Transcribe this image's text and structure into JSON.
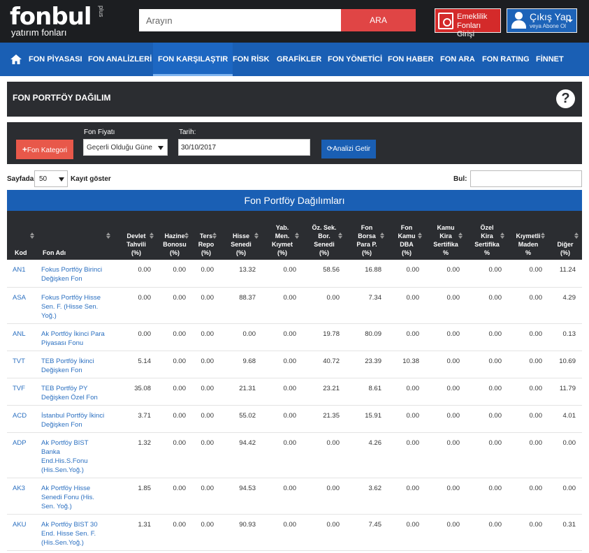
{
  "header": {
    "logo_main": "fonbul",
    "logo_plus": "plus",
    "logo_sub": "yatırım fonları",
    "search_placeholder": "Arayın",
    "search_button": "ARA",
    "emeklilik_line1": "Emeklilik",
    "emeklilik_line2": "Fonları Girişi",
    "user_line1": "Çıkış Yap",
    "user_line2": "veya Abone Ol"
  },
  "nav": {
    "items": [
      "FON PİYASASI",
      "FON ANALİZLERİ",
      "FON KARŞILAŞTIR",
      "FON RİSK",
      "GRAFİKLER",
      "FON YÖNETİCİ",
      "FON HABER",
      "FON ARA",
      "FON RATING",
      "FİNNET"
    ],
    "active_index": 2
  },
  "page": {
    "title": "FON PORTFÖY DAĞILIM",
    "help": "?"
  },
  "filters": {
    "kategori_button": "Fon Kategori",
    "fiyat_label": "Fon Fiyatı",
    "fiyat_value": "Geçerli Olduğu Güne",
    "tarih_label": "Tarih:",
    "tarih_value": "30/10/2017",
    "getir_button": "Analizi Getir"
  },
  "table_controls": {
    "sayfada": "Sayfada",
    "page_size": "50",
    "kayit": "Kayıt göster",
    "bul": "Bul:"
  },
  "table": {
    "title": "Fon Portföy Dağılımları",
    "headers": [
      [
        "Kod"
      ],
      [
        "Fon Adı"
      ],
      [
        "Devlet",
        "Tahvili",
        "(%)"
      ],
      [
        "Hazine",
        "Bonosu",
        "(%)"
      ],
      [
        "Ters",
        "Repo",
        "(%)"
      ],
      [
        "Hisse",
        "Senedi",
        "(%)"
      ],
      [
        "Yab.",
        "Men.",
        "Kıymet",
        "(%)"
      ],
      [
        "Öz. Sek.",
        "Bor.",
        "Senedi",
        "(%)"
      ],
      [
        "Fon",
        "Borsa",
        "Para P.",
        "(%)"
      ],
      [
        "Fon",
        "Kamu",
        "DBA",
        "(%)"
      ],
      [
        "Kamu",
        "Kira",
        "Sertifika",
        "%"
      ],
      [
        "Özel",
        "Kira",
        "Sertifika",
        "%"
      ],
      [
        "Kıymetli",
        "Maden",
        "%"
      ],
      [
        "Diğer",
        "(%)"
      ]
    ],
    "rows": [
      {
        "kod": "AN1",
        "name": [
          "Fokus Portföy Birinci",
          "Değişken Fon"
        ],
        "v": [
          "0.00",
          "0.00",
          "0.00",
          "13.32",
          "0.00",
          "58.56",
          "16.88",
          "0.00",
          "0.00",
          "0.00",
          "0.00",
          "11.24"
        ]
      },
      {
        "kod": "ASA",
        "name": [
          "Fokus Portföy Hisse",
          "Sen. F. (Hisse Sen.",
          "Yoğ.)"
        ],
        "v": [
          "0.00",
          "0.00",
          "0.00",
          "88.37",
          "0.00",
          "0.00",
          "7.34",
          "0.00",
          "0.00",
          "0.00",
          "0.00",
          "4.29"
        ]
      },
      {
        "kod": "ANL",
        "name": [
          "Ak Portföy İkinci Para",
          "Piyasası Fonu"
        ],
        "v": [
          "0.00",
          "0.00",
          "0.00",
          "0.00",
          "0.00",
          "19.78",
          "80.09",
          "0.00",
          "0.00",
          "0.00",
          "0.00",
          "0.13"
        ]
      },
      {
        "kod": "TVT",
        "name": [
          "TEB Portföy İkinci",
          "Değişken Fon"
        ],
        "v": [
          "5.14",
          "0.00",
          "0.00",
          "9.68",
          "0.00",
          "40.72",
          "23.39",
          "10.38",
          "0.00",
          "0.00",
          "0.00",
          "10.69"
        ]
      },
      {
        "kod": "TVF",
        "name": [
          "TEB Portföy PY",
          "Değişken Özel Fon"
        ],
        "v": [
          "35.08",
          "0.00",
          "0.00",
          "21.31",
          "0.00",
          "23.21",
          "8.61",
          "0.00",
          "0.00",
          "0.00",
          "0.00",
          "11.79"
        ]
      },
      {
        "kod": "ACD",
        "name": [
          "İstanbul Portföy İkinci",
          "Değişken Fon"
        ],
        "v": [
          "3.71",
          "0.00",
          "0.00",
          "55.02",
          "0.00",
          "21.35",
          "15.91",
          "0.00",
          "0.00",
          "0.00",
          "0.00",
          "4.01"
        ]
      },
      {
        "kod": "ADP",
        "name": [
          "Ak Portföy BIST",
          "Banka",
          "End.His.S.Fonu",
          "(His.Sen.Yoğ.)"
        ],
        "v": [
          "1.32",
          "0.00",
          "0.00",
          "94.42",
          "0.00",
          "0.00",
          "4.26",
          "0.00",
          "0.00",
          "0.00",
          "0.00",
          "0.00"
        ]
      },
      {
        "kod": "AK3",
        "name": [
          "Ak Portföy Hisse",
          "Senedi Fonu (His.",
          "Sen. Yoğ.)"
        ],
        "v": [
          "1.85",
          "0.00",
          "0.00",
          "94.53",
          "0.00",
          "0.00",
          "3.62",
          "0.00",
          "0.00",
          "0.00",
          "0.00",
          "0.00"
        ]
      },
      {
        "kod": "AKU",
        "name": [
          "Ak Portföy BIST 30",
          "End. Hisse Sen. F.",
          "(His.Sen.Yoğ.)"
        ],
        "v": [
          "1.31",
          "0.00",
          "0.00",
          "90.93",
          "0.00",
          "0.00",
          "7.45",
          "0.00",
          "0.00",
          "0.00",
          "0.00",
          "0.31"
        ]
      }
    ]
  },
  "colors": {
    "topbar": "#1c1e21",
    "nav": "#1a5fb4",
    "panel": "#2b2d31",
    "red": "#e04545",
    "link": "#2a6fc0"
  }
}
